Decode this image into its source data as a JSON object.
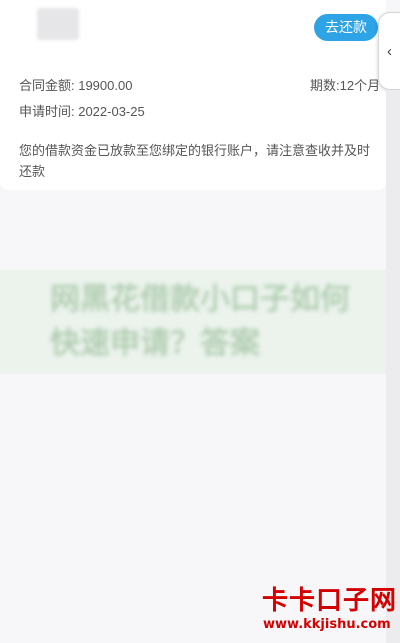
{
  "loan_card": {
    "repay_button_label": "去还款",
    "contract_amount": "合同金额: 19900.00",
    "period": "期数:12个月",
    "apply_time": "申请时间: 2022-03-25",
    "notice": "您的借款资金已放款至您绑定的银行账户，请注意查收并及时还款"
  },
  "side_handle": {
    "icon": "chevron-left-icon",
    "glyph": "‹"
  },
  "overlay_banner": {
    "text": "网黑花借款小口子如何快速申请？答案"
  },
  "watermark": {
    "logo_text": "卡卡口子网",
    "url": "www.kkjishu.com",
    "color": "#d40000"
  },
  "colors": {
    "accent": "#2ea3e6",
    "background": "#f7f7f9",
    "card": "#ffffff"
  }
}
